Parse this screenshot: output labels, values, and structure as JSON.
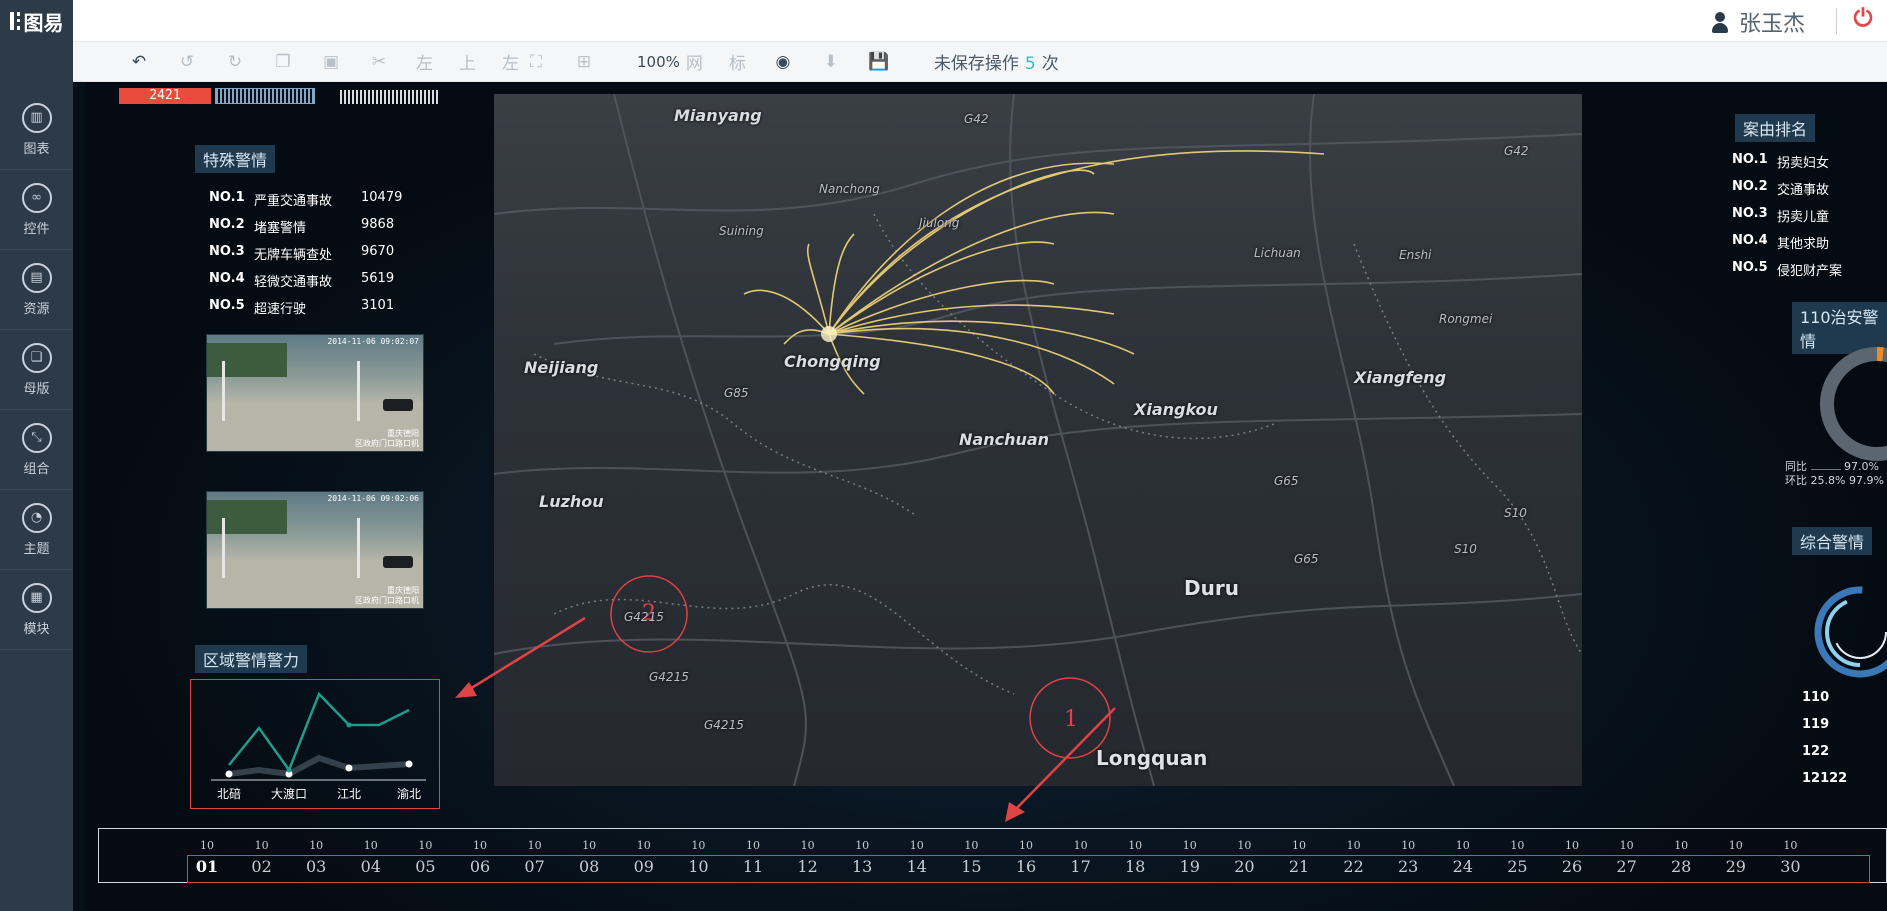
{
  "app": {
    "logo": "图易"
  },
  "user": {
    "name": "张玉杰"
  },
  "toolbar": {
    "align_left": "左",
    "align_top": "上",
    "align_left2": "左",
    "zoom": "100%",
    "grid": "网",
    "ruler": "标",
    "unsaved_prefix": "未保存操作",
    "unsaved_count": "5",
    "unsaved_suffix": "次"
  },
  "sidebar": {
    "items": [
      {
        "label": "图表",
        "icon": "bar-chart-icon"
      },
      {
        "label": "控件",
        "icon": "link-icon"
      },
      {
        "label": "资源",
        "icon": "book-icon"
      },
      {
        "label": "母版",
        "icon": "copy-icon"
      },
      {
        "label": "组合",
        "icon": "merge-icon"
      },
      {
        "label": "主题",
        "icon": "pie-icon"
      },
      {
        "label": "模块",
        "icon": "file-icon"
      }
    ]
  },
  "header_counter": "2421",
  "special_alerts": {
    "title": "特殊警情",
    "rows": [
      {
        "no": "NO.1",
        "name": "严重交通事故",
        "value": "10479"
      },
      {
        "no": "NO.2",
        "name": "堵塞警情",
        "value": "9868"
      },
      {
        "no": "NO.3",
        "name": "无牌车辆查处",
        "value": "9670"
      },
      {
        "no": "NO.4",
        "name": "轻微交通事故",
        "value": "5619"
      },
      {
        "no": "NO.5",
        "name": "超速行驶",
        "value": "3101"
      }
    ]
  },
  "cameras": [
    {
      "timestamp": "2014-11-06 09:02:07",
      "caption1": "重庆德阳",
      "caption2": "区政府门口路口机"
    },
    {
      "timestamp": "2014-11-06 09:02:06",
      "caption1": "重庆德阳",
      "caption2": "区政府门口路口机"
    }
  ],
  "regional": {
    "title": "区域警情警力",
    "categories": [
      "北碚",
      "大渡口",
      "江北",
      "渝北"
    ]
  },
  "map": {
    "labels": {
      "mianyang": "Mianyang",
      "nanchong": "Nanchong",
      "suining": "Suining",
      "jiulong": "Jiulong",
      "neijiang": "Neijiang",
      "chongqing": "Chongqing",
      "nanchuan": "Nanchuan",
      "xiangkou": "Xiangkou",
      "luzhou": "Luzhou",
      "duru": "Duru",
      "longquan": "Longquan",
      "lichuan": "Lichuan",
      "enshi": "Enshi",
      "rongmei": "Rongmei",
      "xiangfeng": "Xiangfeng",
      "g4215a": "G4215",
      "g4215b": "G4215",
      "g4215c": "G4215",
      "g42": "G42",
      "g42b": "G42",
      "g65": "G65",
      "g65b": "G65",
      "g85": "G85",
      "s10": "S10",
      "s10b": "S10"
    }
  },
  "case_ranking": {
    "title": "案由排名",
    "rows": [
      {
        "no": "NO.1",
        "name": "拐卖妇女"
      },
      {
        "no": "NO.2",
        "name": "交通事故"
      },
      {
        "no": "NO.3",
        "name": "拐卖儿童"
      },
      {
        "no": "NO.4",
        "name": "其他求助"
      },
      {
        "no": "NO.5",
        "name": "侵犯财产案"
      }
    ]
  },
  "security_110": {
    "title": "110治安警情",
    "yoy_label": "同比",
    "yoy_value": "97.0%",
    "mom_label": "环比",
    "mom_value": "25.8%",
    "mom_value2": "97.9%"
  },
  "comprehensive": {
    "title": "综合警情",
    "items": [
      "110",
      "119",
      "122",
      "12122"
    ]
  },
  "timeline": {
    "top_values": [
      "10",
      "10",
      "10",
      "10",
      "10",
      "10",
      "10",
      "10",
      "10",
      "10",
      "10",
      "10",
      "10",
      "10",
      "10",
      "10",
      "10",
      "10",
      "10",
      "10",
      "10",
      "10",
      "10",
      "10",
      "10",
      "10",
      "10",
      "10",
      "10",
      "10"
    ],
    "days": [
      "01",
      "02",
      "03",
      "04",
      "05",
      "06",
      "07",
      "08",
      "09",
      "10",
      "11",
      "12",
      "13",
      "14",
      "15",
      "16",
      "17",
      "18",
      "19",
      "20",
      "21",
      "22",
      "23",
      "24",
      "25",
      "26",
      "27",
      "28",
      "29",
      "30"
    ],
    "active_index": 0
  },
  "annotations": {
    "marker1": "1",
    "marker2": "2"
  },
  "colors": {
    "accent_red": "#e84c3d",
    "teal_line": "#1e9d8a",
    "toolbar_accent": "#3db7c9",
    "sidebar_bg": "#2d3a47"
  }
}
